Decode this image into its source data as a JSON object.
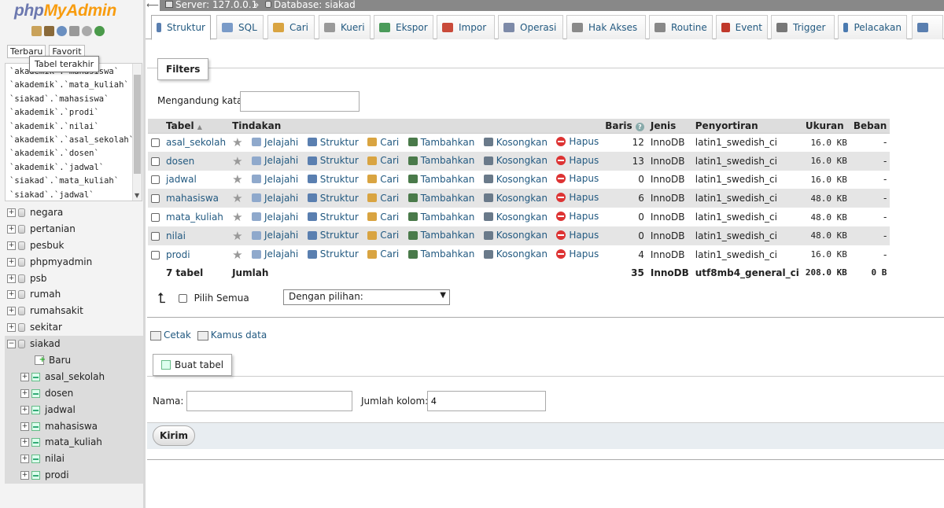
{
  "nav": {
    "logo_php": "php",
    "logo_myadmin": "MyAdmin",
    "tab_recent": "Terbaru",
    "tab_favorite": "Favorit",
    "tooltip": "Tabel terakhir",
    "recent_items": [
      "`akademik`.`mahasiswa`",
      "`akademik`.`mata_kuliah`",
      "`siakad`.`mahasiswa`",
      "`akademik`.`prodi`",
      "`akademik`.`nilai`",
      "`akademik`.`asal_sekolah`",
      "`akademik`.`dosen`",
      "`akademik`.`jadwal`",
      "`siakad`.`mata_kuliah`",
      "`siakad`.`jadwal`"
    ],
    "databases": [
      "negara",
      "pertanian",
      "pesbuk",
      "phpmyadmin",
      "psb",
      "rumah",
      "rumahsakit",
      "sekitar",
      "siakad"
    ],
    "new_label": "Baru",
    "siakad_tables": [
      "asal_sekolah",
      "dosen",
      "jadwal",
      "mahasiswa",
      "mata_kuliah",
      "nilai",
      "prodi"
    ]
  },
  "breadcrumb": {
    "server": "Server: 127.0.0.1",
    "sep": "»",
    "database": "Database: siakad"
  },
  "menu": [
    {
      "label": "Struktur",
      "color": "#5a7fb0"
    },
    {
      "label": "SQL",
      "color": "#7a9bc8"
    },
    {
      "label": "Cari",
      "color": "#d9a441"
    },
    {
      "label": "Kueri",
      "color": "#999999"
    },
    {
      "label": "Ekspor",
      "color": "#4b9b5a"
    },
    {
      "label": "Impor",
      "color": "#c94a3a"
    },
    {
      "label": "Operasi",
      "color": "#7d8aa8"
    },
    {
      "label": "Hak Akses",
      "color": "#8a8a8a"
    },
    {
      "label": "Routine",
      "color": "#888888"
    },
    {
      "label": "Event",
      "color": "#c0392b"
    },
    {
      "label": "Trigger",
      "color": "#777777"
    },
    {
      "label": "Pelacakan",
      "color": "#4a7ab0"
    }
  ],
  "filters": {
    "legend": "Filters",
    "contains_label": "Mengandung kata:",
    "contains_value": ""
  },
  "table": {
    "headers": {
      "table": "Tabel",
      "actions": "Tindakan",
      "rows": "Baris",
      "type": "Jenis",
      "collation": "Penyortiran",
      "size": "Ukuran",
      "overhead": "Beban"
    },
    "actions": {
      "browse": "Jelajahi",
      "structure": "Struktur",
      "search": "Cari",
      "insert": "Tambahkan",
      "empty": "Kosongkan",
      "drop": "Hapus"
    },
    "rows": [
      {
        "name": "asal_sekolah",
        "rows": "12",
        "engine": "InnoDB",
        "collation": "latin1_swedish_ci",
        "size": "16.0 KB",
        "overhead": "-"
      },
      {
        "name": "dosen",
        "rows": "13",
        "engine": "InnoDB",
        "collation": "latin1_swedish_ci",
        "size": "16.0 KB",
        "overhead": "-"
      },
      {
        "name": "jadwal",
        "rows": "0",
        "engine": "InnoDB",
        "collation": "latin1_swedish_ci",
        "size": "16.0 KB",
        "overhead": "-"
      },
      {
        "name": "mahasiswa",
        "rows": "6",
        "engine": "InnoDB",
        "collation": "latin1_swedish_ci",
        "size": "48.0 KB",
        "overhead": "-"
      },
      {
        "name": "mata_kuliah",
        "rows": "0",
        "engine": "InnoDB",
        "collation": "latin1_swedish_ci",
        "size": "48.0 KB",
        "overhead": "-"
      },
      {
        "name": "nilai",
        "rows": "0",
        "engine": "InnoDB",
        "collation": "latin1_swedish_ci",
        "size": "48.0 KB",
        "overhead": "-"
      },
      {
        "name": "prodi",
        "rows": "4",
        "engine": "InnoDB",
        "collation": "latin1_swedish_ci",
        "size": "16.0 KB",
        "overhead": "-"
      }
    ],
    "total": {
      "label": "7 tabel",
      "sum_label": "Jumlah",
      "rows": "35",
      "engine": "InnoDB",
      "collation": "utf8mb4_general_ci",
      "size": "208.0 KB",
      "overhead": "0 B"
    }
  },
  "with_selected": {
    "check_all": "Pilih Semua",
    "select_value": "Dengan pilihan:"
  },
  "links": {
    "print": "Cetak",
    "dictionary": "Kamus data"
  },
  "create_table": {
    "legend": "Buat tabel",
    "name_label": "Nama:",
    "name_value": "",
    "columns_label": "Jumlah kolom:",
    "columns_value": "4",
    "submit": "Kirim"
  }
}
